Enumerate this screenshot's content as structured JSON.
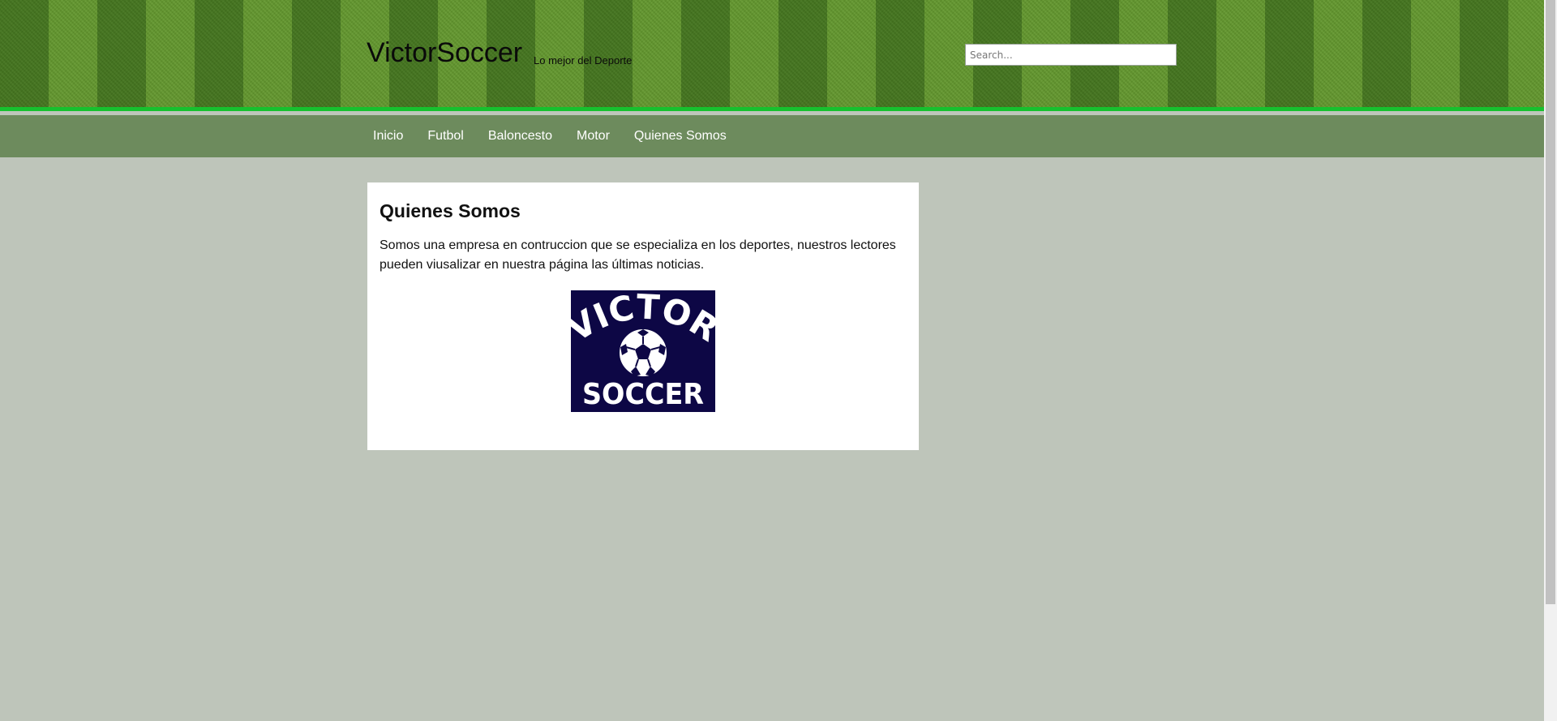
{
  "header": {
    "site_title": "VictorSoccer",
    "tagline": "Lo mejor del Deporte",
    "search_placeholder": "Search..."
  },
  "nav": {
    "items": [
      {
        "label": "Inicio"
      },
      {
        "label": "Futbol"
      },
      {
        "label": "Baloncesto"
      },
      {
        "label": "Motor"
      },
      {
        "label": "Quienes Somos"
      }
    ]
  },
  "content": {
    "title": "Quienes Somos",
    "paragraph": "Somos una empresa en contruccion que se especializa en los deportes, nuestros lectores pueden viusalizar en nuestra página las últimas noticias.",
    "logo": {
      "top_text": "VICTOR",
      "bottom_text": "SOCCER",
      "background": "#0d0745",
      "icon": "soccer-ball-icon"
    }
  },
  "colors": {
    "accent_line": "#16c12e",
    "nav_bg": "#6d8b5d",
    "page_bg": "#bec5ba"
  }
}
